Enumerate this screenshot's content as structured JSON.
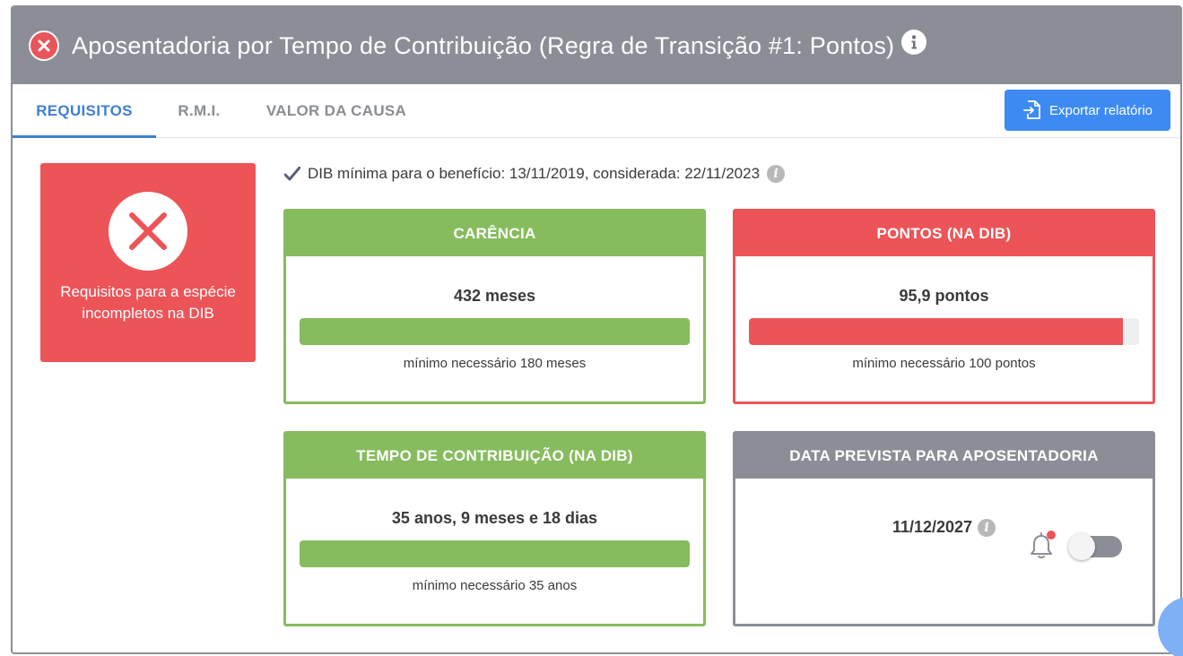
{
  "header": {
    "title": "Aposentadoria por Tempo de Contribuição (Regra de Transição #1: Pontos)",
    "status_icon": "close-circle-icon",
    "info_icon": "info-icon"
  },
  "tabs": [
    {
      "label": "REQUISITOS",
      "active": true
    },
    {
      "label": "R.M.I.",
      "active": false
    },
    {
      "label": "VALOR DA CAUSA",
      "active": false
    }
  ],
  "export_button": {
    "label": "Exportar relatório",
    "icon": "export-file-icon"
  },
  "status": {
    "text": "Requisitos para a espécie incompletos na DIB",
    "icon": "x-icon"
  },
  "dib": {
    "text": "DIB mínima para o benefício: 13/11/2019, considerada: 22/11/2023",
    "icon": "check-icon"
  },
  "cards": {
    "carencia": {
      "title": "CARÊNCIA",
      "value": "432 meses",
      "progress_percent": 100,
      "minimum": "mínimo necessário 180 meses",
      "color": "#86bc5d"
    },
    "pontos": {
      "title": "PONTOS (NA DIB)",
      "value": "95,9 pontos",
      "progress_percent": 95.9,
      "minimum": "mínimo necessário 100 pontos",
      "color": "#ec5458"
    },
    "tempo": {
      "title": "TEMPO DE CONTRIBUIÇÃO (NA DIB)",
      "value": "35 anos, 9 meses e 18 dias",
      "progress_percent": 100,
      "minimum": "mínimo necessário 35 anos",
      "color": "#86bc5d"
    },
    "data_prevista": {
      "title": "DATA PREVISTA PARA APOSENTADORIA",
      "value": "11/12/2027",
      "notification_icon": "bell-icon",
      "toggle_on": false,
      "color": "#8b8e96"
    }
  },
  "colors": {
    "header_bg": "#8b8e96",
    "accent_blue": "#3d8bf2",
    "active_tab": "#3f7fd4",
    "error_red": "#ec5458",
    "success_green": "#86bc5d"
  }
}
